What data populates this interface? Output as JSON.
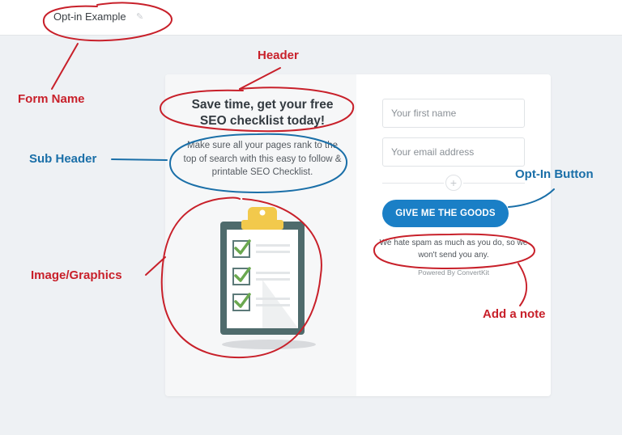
{
  "app": {
    "form_name": "Opt-in Example",
    "edit_icon": "pencil-icon"
  },
  "form": {
    "header": "Save time, get your free SEO checklist today!",
    "subheader": "Make sure all your pages rank to the top of search with this easy to follow & printable SEO Checklist.",
    "image_icon": "clipboard-checklist-icon",
    "first_name_placeholder": "Your first name",
    "email_placeholder": "Your email address",
    "divider_icon": "plus-icon",
    "button_label": "GIVE ME THE GOODS",
    "note": "We hate spam as much as you do, so we won't send you any.",
    "powered_by": "Powered By ConvertKit"
  },
  "annotations": {
    "form_name": "Form Name",
    "header": "Header",
    "sub_header": "Sub Header",
    "image_graphics": "Image/Graphics",
    "opt_in_button": "Opt-In Button",
    "add_note": "Add a note"
  },
  "colors": {
    "button": "#1a7fc6",
    "annotation_red": "#c8202a",
    "annotation_blue": "#1a6fa8",
    "page_background": "#eef1f4"
  }
}
